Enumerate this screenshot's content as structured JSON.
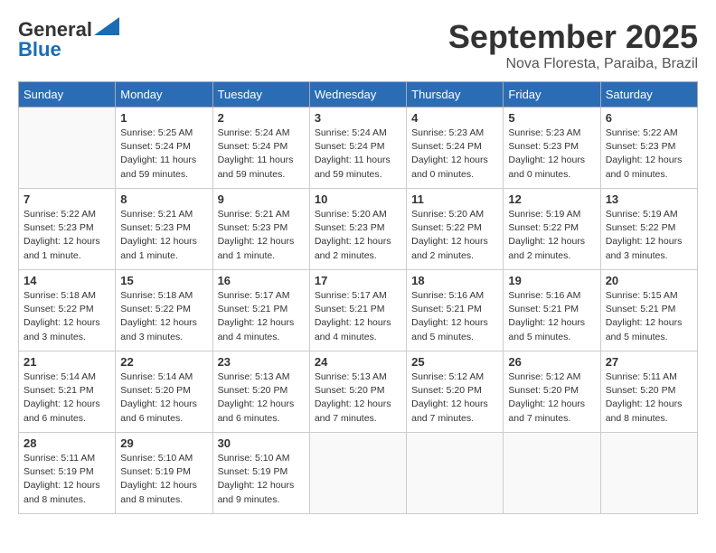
{
  "header": {
    "logo_line1": "General",
    "logo_line2": "Blue",
    "month": "September 2025",
    "location": "Nova Floresta, Paraiba, Brazil"
  },
  "weekdays": [
    "Sunday",
    "Monday",
    "Tuesday",
    "Wednesday",
    "Thursday",
    "Friday",
    "Saturday"
  ],
  "weeks": [
    [
      {
        "day": "",
        "info": ""
      },
      {
        "day": "1",
        "info": "Sunrise: 5:25 AM\nSunset: 5:24 PM\nDaylight: 11 hours\nand 59 minutes."
      },
      {
        "day": "2",
        "info": "Sunrise: 5:24 AM\nSunset: 5:24 PM\nDaylight: 11 hours\nand 59 minutes."
      },
      {
        "day": "3",
        "info": "Sunrise: 5:24 AM\nSunset: 5:24 PM\nDaylight: 11 hours\nand 59 minutes."
      },
      {
        "day": "4",
        "info": "Sunrise: 5:23 AM\nSunset: 5:24 PM\nDaylight: 12 hours\nand 0 minutes."
      },
      {
        "day": "5",
        "info": "Sunrise: 5:23 AM\nSunset: 5:23 PM\nDaylight: 12 hours\nand 0 minutes."
      },
      {
        "day": "6",
        "info": "Sunrise: 5:22 AM\nSunset: 5:23 PM\nDaylight: 12 hours\nand 0 minutes."
      }
    ],
    [
      {
        "day": "7",
        "info": "Sunrise: 5:22 AM\nSunset: 5:23 PM\nDaylight: 12 hours\nand 1 minute."
      },
      {
        "day": "8",
        "info": "Sunrise: 5:21 AM\nSunset: 5:23 PM\nDaylight: 12 hours\nand 1 minute."
      },
      {
        "day": "9",
        "info": "Sunrise: 5:21 AM\nSunset: 5:23 PM\nDaylight: 12 hours\nand 1 minute."
      },
      {
        "day": "10",
        "info": "Sunrise: 5:20 AM\nSunset: 5:23 PM\nDaylight: 12 hours\nand 2 minutes."
      },
      {
        "day": "11",
        "info": "Sunrise: 5:20 AM\nSunset: 5:22 PM\nDaylight: 12 hours\nand 2 minutes."
      },
      {
        "day": "12",
        "info": "Sunrise: 5:19 AM\nSunset: 5:22 PM\nDaylight: 12 hours\nand 2 minutes."
      },
      {
        "day": "13",
        "info": "Sunrise: 5:19 AM\nSunset: 5:22 PM\nDaylight: 12 hours\nand 3 minutes."
      }
    ],
    [
      {
        "day": "14",
        "info": "Sunrise: 5:18 AM\nSunset: 5:22 PM\nDaylight: 12 hours\nand 3 minutes."
      },
      {
        "day": "15",
        "info": "Sunrise: 5:18 AM\nSunset: 5:22 PM\nDaylight: 12 hours\nand 3 minutes."
      },
      {
        "day": "16",
        "info": "Sunrise: 5:17 AM\nSunset: 5:21 PM\nDaylight: 12 hours\nand 4 minutes."
      },
      {
        "day": "17",
        "info": "Sunrise: 5:17 AM\nSunset: 5:21 PM\nDaylight: 12 hours\nand 4 minutes."
      },
      {
        "day": "18",
        "info": "Sunrise: 5:16 AM\nSunset: 5:21 PM\nDaylight: 12 hours\nand 5 minutes."
      },
      {
        "day": "19",
        "info": "Sunrise: 5:16 AM\nSunset: 5:21 PM\nDaylight: 12 hours\nand 5 minutes."
      },
      {
        "day": "20",
        "info": "Sunrise: 5:15 AM\nSunset: 5:21 PM\nDaylight: 12 hours\nand 5 minutes."
      }
    ],
    [
      {
        "day": "21",
        "info": "Sunrise: 5:14 AM\nSunset: 5:21 PM\nDaylight: 12 hours\nand 6 minutes."
      },
      {
        "day": "22",
        "info": "Sunrise: 5:14 AM\nSunset: 5:20 PM\nDaylight: 12 hours\nand 6 minutes."
      },
      {
        "day": "23",
        "info": "Sunrise: 5:13 AM\nSunset: 5:20 PM\nDaylight: 12 hours\nand 6 minutes."
      },
      {
        "day": "24",
        "info": "Sunrise: 5:13 AM\nSunset: 5:20 PM\nDaylight: 12 hours\nand 7 minutes."
      },
      {
        "day": "25",
        "info": "Sunrise: 5:12 AM\nSunset: 5:20 PM\nDaylight: 12 hours\nand 7 minutes."
      },
      {
        "day": "26",
        "info": "Sunrise: 5:12 AM\nSunset: 5:20 PM\nDaylight: 12 hours\nand 7 minutes."
      },
      {
        "day": "27",
        "info": "Sunrise: 5:11 AM\nSunset: 5:20 PM\nDaylight: 12 hours\nand 8 minutes."
      }
    ],
    [
      {
        "day": "28",
        "info": "Sunrise: 5:11 AM\nSunset: 5:19 PM\nDaylight: 12 hours\nand 8 minutes."
      },
      {
        "day": "29",
        "info": "Sunrise: 5:10 AM\nSunset: 5:19 PM\nDaylight: 12 hours\nand 8 minutes."
      },
      {
        "day": "30",
        "info": "Sunrise: 5:10 AM\nSunset: 5:19 PM\nDaylight: 12 hours\nand 9 minutes."
      },
      {
        "day": "",
        "info": ""
      },
      {
        "day": "",
        "info": ""
      },
      {
        "day": "",
        "info": ""
      },
      {
        "day": "",
        "info": ""
      }
    ]
  ]
}
